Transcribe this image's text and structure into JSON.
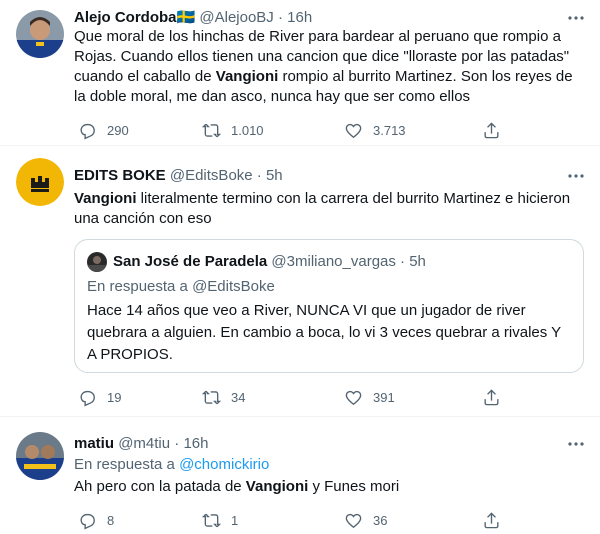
{
  "tweets": [
    {
      "name": "Alejo Cordoba",
      "flag": "🇸🇪",
      "handle": "@AlejooBJ",
      "sep": "·",
      "time": "16h",
      "lines": [
        "Que moral de los hinchas de River para bardear al peruano que rompio a",
        "Rojas. Cuando ellos tienen una cancion que dice \"lloraste por las patadas\"",
        "cuando el caballo de ",
        "Vangioni",
        " rompio al burrito Martinez. Son los reyes de",
        "la doble moral, me dan asco, nunca hay que ser como ellos"
      ],
      "replies": "290",
      "retweets": "1.010",
      "likes": "3.713"
    },
    {
      "name": "EDITS BOKE",
      "handle": "@EditsBoke",
      "sep": "·",
      "time": "5h",
      "text_bold": "Vangioni",
      "text_rest_1": " literalmente termino con la carrera del burrito Martinez e hicieron",
      "text_rest_2": "una canción con eso",
      "quote": {
        "name": "San José de Paradela",
        "handle": "@3miliano_vargas",
        "sep": "·",
        "time": "5h",
        "reply_prefix": "En respuesta a ",
        "reply_to": "@EditsBoke",
        "lines": [
          "Hace 14 años que veo a River, NUNCA VI que un jugador de river",
          "quebrara a alguien. En cambio a boca, lo vi 3 veces quebrar a rivales Y",
          "A PROPIOS."
        ]
      },
      "replies": "19",
      "retweets": "34",
      "likes": "391"
    },
    {
      "name": "matiu",
      "handle": "@m4tiu",
      "sep": "·",
      "time": "16h",
      "reply_prefix": "En respuesta a ",
      "reply_to": "@chomickirio",
      "text_pre": "Ah pero con la patada de ",
      "text_bold": "Vangioni",
      "text_post": " y Funes mori",
      "replies": "8",
      "retweets": "1",
      "likes": "36"
    }
  ]
}
